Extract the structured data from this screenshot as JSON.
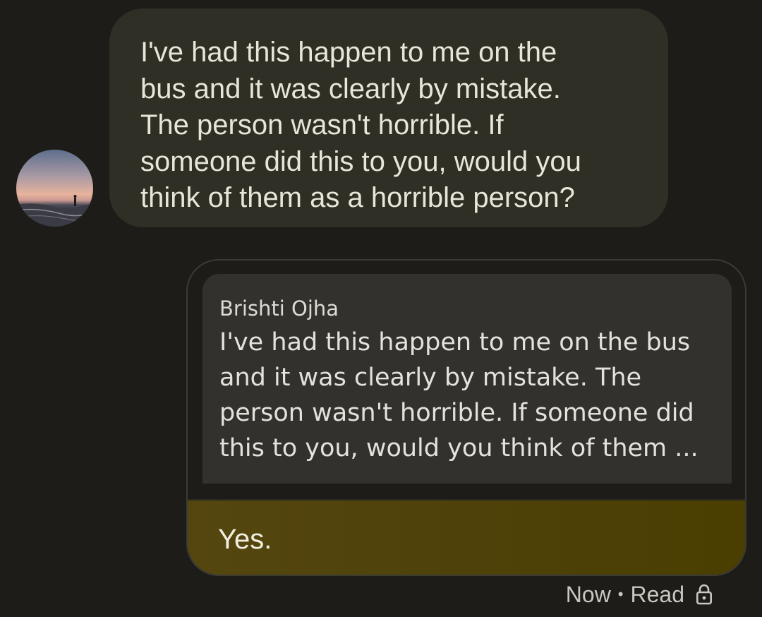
{
  "incoming": {
    "sender": "Brishti Ojha",
    "avatar_icon": "avatar-beach-sunset",
    "lines": [
      "I've had this happen to me on the",
      "bus and it was clearly by mistake.",
      "The person wasn't horrible. If",
      "someone did this to you, would you",
      "think of them as a horrible person?"
    ]
  },
  "outgoing": {
    "quote": {
      "sender": "Brishti Ojha",
      "lines": [
        "I've had this happen to me on the bus",
        "and it was clearly by mistake. The",
        "person wasn't horrible. If someone did",
        "this to you, would you think of them ..."
      ]
    },
    "reply_text": "Yes.",
    "status": {
      "time": "Now",
      "separator": "•",
      "state": "Read",
      "icon": "lock-icon"
    }
  },
  "colors": {
    "background": "#1d1c19",
    "incoming_bubble": "#2f2f25",
    "quote_card": "#32312e",
    "reply_bubble": "#4e420a"
  }
}
